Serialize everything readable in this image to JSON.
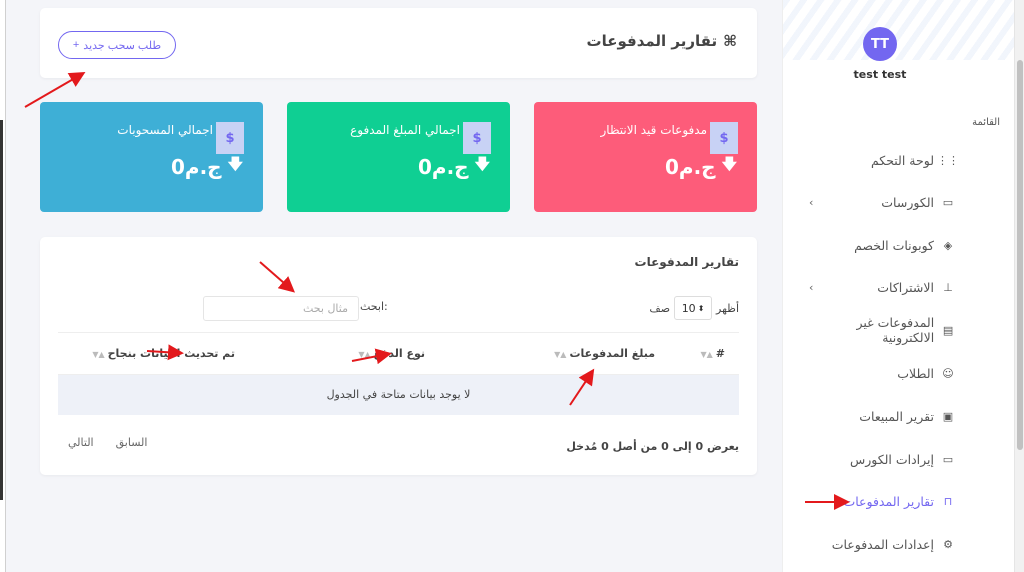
{
  "sidebar": {
    "avatar_initials": "TT",
    "username": "test test",
    "menu_title": "القائمة",
    "items": [
      {
        "label": "لوحة التحكم",
        "icon": "grid-icon"
      },
      {
        "label": "الكورسات",
        "icon": "box-icon",
        "has_submenu": true
      },
      {
        "label": "كوبونات الخصم",
        "icon": "tag-icon"
      },
      {
        "label": "الاشتراكات",
        "icon": "sitemap-icon",
        "has_submenu": true
      },
      {
        "label": "المدفوعات غير الالكترونية",
        "icon": "archive-icon"
      },
      {
        "label": "الطلاب",
        "icon": "users-icon"
      },
      {
        "label": "تقرير المبيعات",
        "icon": "clipboard-icon"
      },
      {
        "label": "إيرادات الكورس",
        "icon": "box-icon"
      },
      {
        "label": "تقارير المدفوعات",
        "icon": "lock-icon",
        "active": true
      },
      {
        "label": "إعدادات المدفوعات",
        "icon": "gear-icon"
      }
    ]
  },
  "header": {
    "title": "تقارير المدفوعات",
    "new_withdraw_label": "طلب سحب جديد",
    "new_withdraw_prefix": "+"
  },
  "stats": [
    {
      "title": "اجمالي المسحوبات",
      "amount": "0ج.م",
      "currency_icon": "$",
      "color": "#3eafd6"
    },
    {
      "title": "اجمالي المبلغ المدفوع",
      "amount": "0ج.م",
      "currency_icon": "$",
      "color": "#0fcf93"
    },
    {
      "title": "مدفوعات قيد الانتظار",
      "amount": "0ج.م",
      "currency_icon": "$",
      "color": "#fd5c7a"
    }
  ],
  "report": {
    "title": "تقارير المدفوعات",
    "show_label": "أظهر",
    "show_value": "10",
    "rows_label": "صف",
    "search_label": "ابحث:",
    "search_placeholder": "مثال بحث",
    "columns": [
      "#",
      "مبلغ المدفوعات",
      "نوع الدفع",
      "تم تحديث البيانات بنجاح"
    ],
    "empty_message": "لا يوجد بيانات متاحة في الجدول",
    "info": "يعرض 0 إلى 0 من أصل 0 مُدخل",
    "prev_label": "السابق",
    "next_label": "التالي"
  },
  "colors": {
    "accent": "#7367f0",
    "annotation": "#e3191c"
  }
}
